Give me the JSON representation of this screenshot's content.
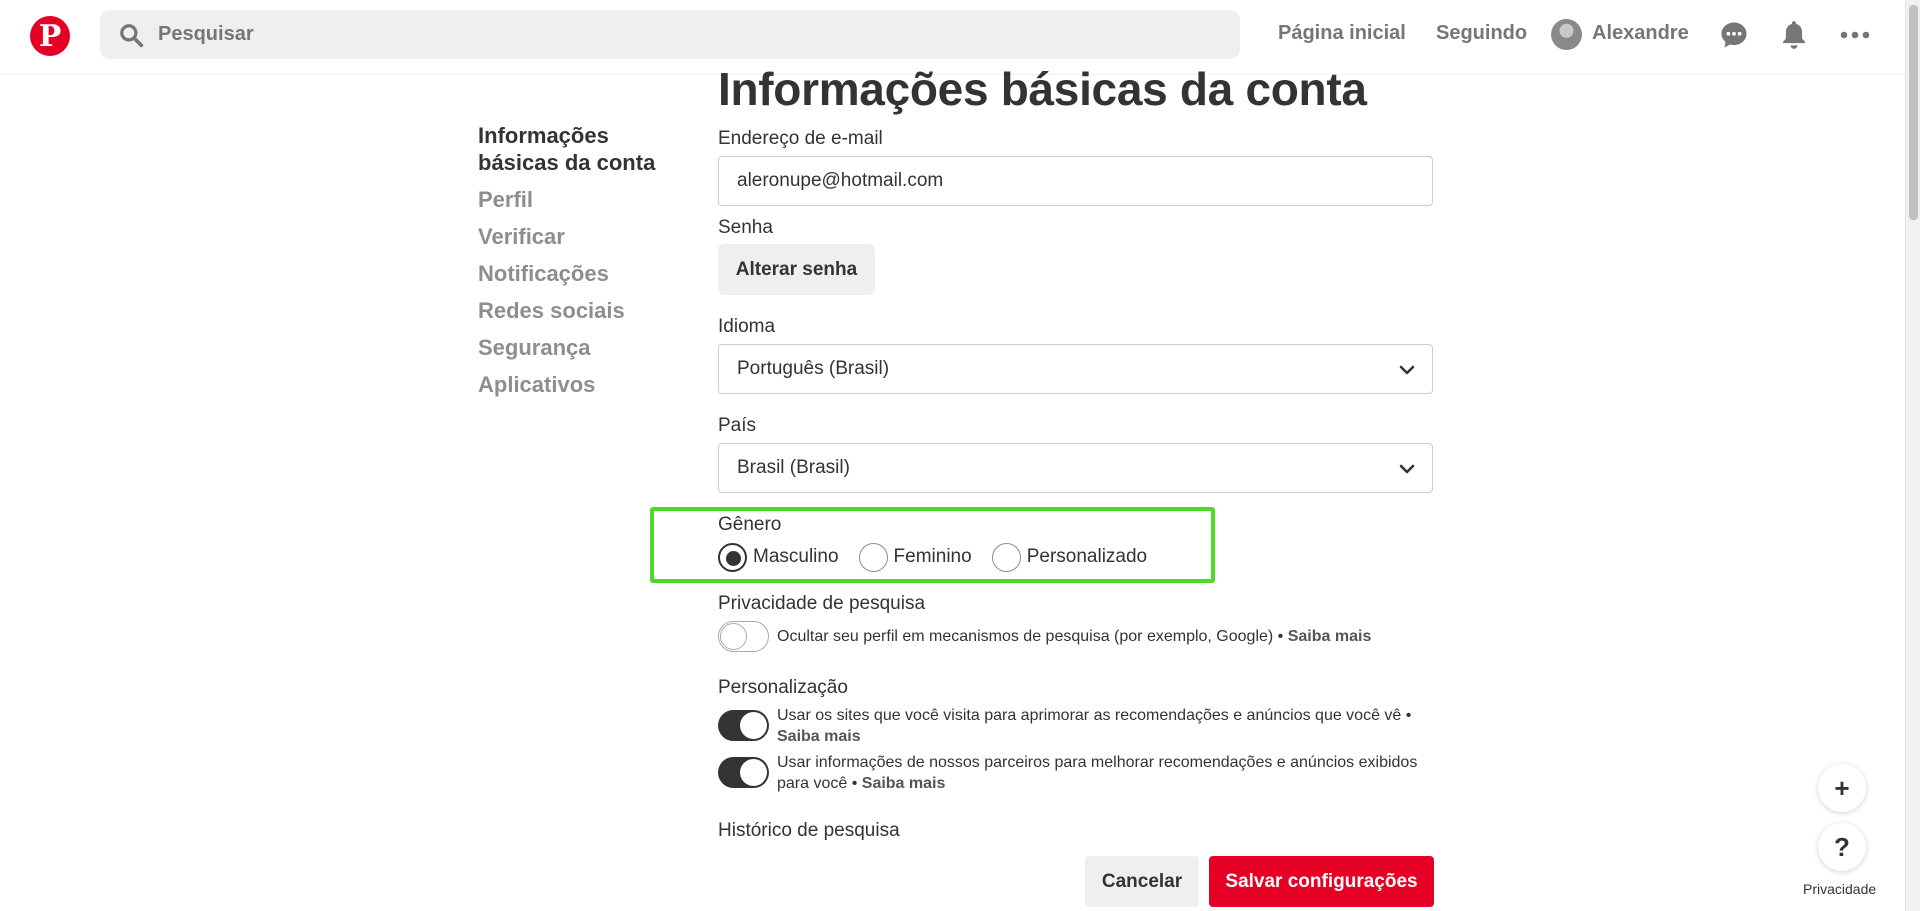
{
  "header": {
    "search_placeholder": "Pesquisar",
    "nav_home": "Página inicial",
    "nav_following": "Seguindo",
    "user_name": "Alexandre"
  },
  "sidebar": {
    "items": [
      {
        "label": "Informações básicas da conta",
        "active": true
      },
      {
        "label": "Perfil"
      },
      {
        "label": "Verificar"
      },
      {
        "label": "Notificações"
      },
      {
        "label": "Redes sociais"
      },
      {
        "label": "Segurança"
      },
      {
        "label": "Aplicativos"
      }
    ]
  },
  "main": {
    "title": "Informações básicas da conta",
    "email_label": "Endereço de e-mail",
    "email_value": "aleronupe@hotmail.com",
    "password_label": "Senha",
    "change_password_button": "Alterar senha",
    "language_label": "Idioma",
    "language_value": "Português (Brasil)",
    "country_label": "País",
    "country_value": "Brasil (Brasil)",
    "gender_label": "Gênero",
    "gender_options": [
      "Masculino",
      "Feminino",
      "Personalizado"
    ],
    "gender_selected": "Masculino",
    "search_privacy_label": "Privacidade de pesquisa",
    "search_privacy_text": "Ocultar seu perfil em mecanismos de pesquisa (por exemplo, Google) •",
    "search_privacy_on": false,
    "learn_more": "Saiba mais",
    "personalization_label": "Personalização",
    "personalization_1_text": "Usar os sites que você visita para aprimorar as recomendações e anúncios que você vê •",
    "personalization_1_on": true,
    "personalization_2_text": "Usar informações de nossos parceiros para melhorar recomendações e anúncios exibidos para você •",
    "personalization_2_on": true,
    "search_history_label": "Histórico de pesquisa",
    "cancel_button": "Cancelar",
    "save_button": "Salvar configurações"
  },
  "floating": {
    "plus_symbol": "+",
    "help_symbol": "?",
    "privacy_label": "Privacidade"
  },
  "colors": {
    "brand": "#e60023",
    "highlight": "#4cdb26"
  }
}
